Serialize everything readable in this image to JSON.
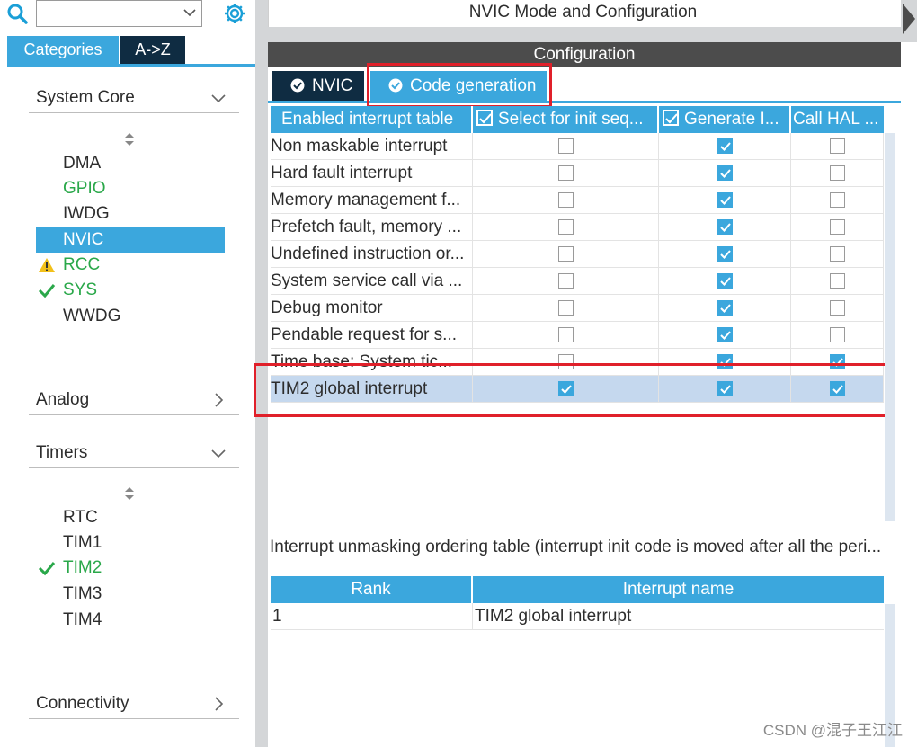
{
  "left": {
    "search": {
      "value": "",
      "placeholder": ""
    },
    "tabs": [
      {
        "label": "Categories"
      },
      {
        "label": "A->Z"
      }
    ],
    "sections": {
      "system_core": {
        "label": "System Core",
        "items": [
          {
            "label": "DMA",
            "status": "none"
          },
          {
            "label": "GPIO",
            "status": "green"
          },
          {
            "label": "IWDG",
            "status": "none"
          },
          {
            "label": "NVIC",
            "status": "selected"
          },
          {
            "label": "RCC",
            "status": "warning"
          },
          {
            "label": "SYS",
            "status": "check"
          },
          {
            "label": "WWDG",
            "status": "none"
          }
        ]
      },
      "analog": {
        "label": "Analog"
      },
      "timers": {
        "label": "Timers",
        "items": [
          {
            "label": "RTC",
            "status": "none"
          },
          {
            "label": "TIM1",
            "status": "none"
          },
          {
            "label": "TIM2",
            "status": "check"
          },
          {
            "label": "TIM3",
            "status": "none"
          },
          {
            "label": "TIM4",
            "status": "none"
          }
        ]
      },
      "connectivity": {
        "label": "Connectivity"
      }
    }
  },
  "right": {
    "mode_title": "NVIC Mode and Configuration",
    "config_title": "Configuration",
    "tabs": [
      {
        "label": "NVIC"
      },
      {
        "label": "Code generation"
      }
    ],
    "table": {
      "headers": [
        "Enabled interrupt table",
        "Select for init seq...",
        "Generate I...",
        "Call HAL ..."
      ],
      "rows": [
        {
          "name": "Non maskable interrupt",
          "init": false,
          "gen": true,
          "hal": false
        },
        {
          "name": "Hard fault interrupt",
          "init": false,
          "gen": true,
          "hal": false
        },
        {
          "name": "Memory management f...",
          "init": false,
          "gen": true,
          "hal": false
        },
        {
          "name": "Prefetch fault, memory ...",
          "init": false,
          "gen": true,
          "hal": false
        },
        {
          "name": "Undefined instruction or...",
          "init": false,
          "gen": true,
          "hal": false
        },
        {
          "name": "System service call via ...",
          "init": false,
          "gen": true,
          "hal": false
        },
        {
          "name": "Debug monitor",
          "init": false,
          "gen": true,
          "hal": false
        },
        {
          "name": "Pendable request for s...",
          "init": false,
          "gen": true,
          "hal": false
        },
        {
          "name": "Time base: System tic...",
          "init": false,
          "gen": true,
          "hal": true
        },
        {
          "name": "TIM2 global interrupt",
          "init": true,
          "gen": true,
          "hal": true,
          "selected": true
        }
      ]
    },
    "unmask_label": "Interrupt unmasking ordering table (interrupt init code is moved after all the peri...",
    "rank_table": {
      "headers": [
        "Rank",
        "Interrupt name"
      ],
      "rows": [
        {
          "rank": "1",
          "name": "TIM2 global interrupt"
        }
      ]
    }
  },
  "watermark": "CSDN @混子王江江",
  "colors": {
    "accent": "#3ba7dd",
    "dark_tab": "#0f2c42",
    "green": "#2aa84a",
    "highlight": "#e0202a",
    "selected_row": "#c5d8ee"
  }
}
